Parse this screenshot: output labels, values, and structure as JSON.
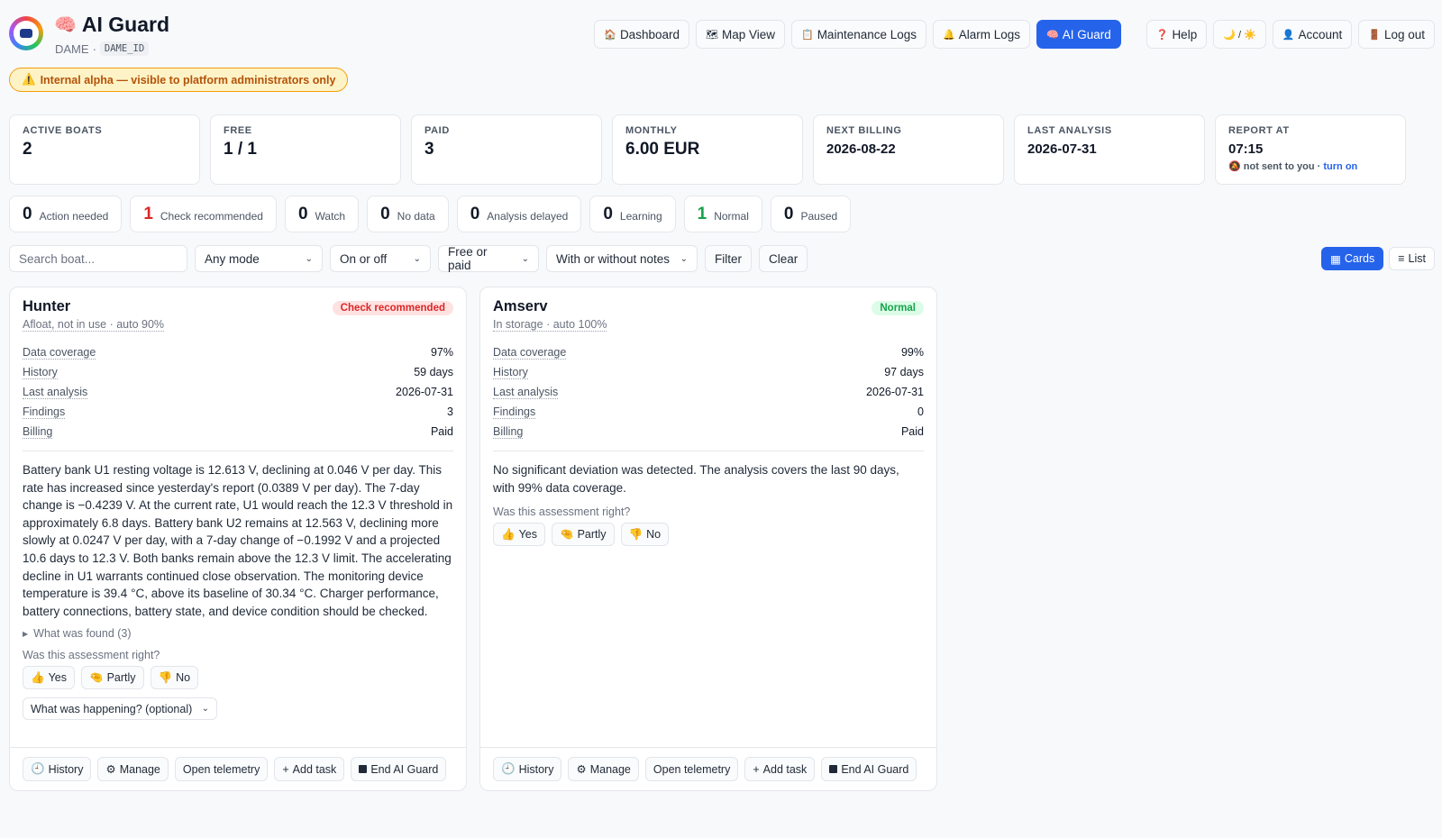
{
  "app": {
    "title": "AI Guard",
    "title_icon": "brain-icon",
    "org": "DAME",
    "separator": "·",
    "org_id": "DAME_ID"
  },
  "nav": [
    {
      "icon": "🏠",
      "icon_name": "home-icon",
      "label": "Dashboard",
      "active": false
    },
    {
      "icon": "🗺",
      "icon_name": "map-icon",
      "label": "Map View",
      "active": false
    },
    {
      "icon": "📋",
      "icon_name": "clipboard-icon",
      "label": "Maintenance Logs",
      "active": false
    },
    {
      "icon": "🔔",
      "icon_name": "bell-icon",
      "label": "Alarm Logs",
      "active": false
    },
    {
      "icon": "🧠",
      "icon_name": "brain-icon",
      "label": "AI Guard",
      "active": true
    }
  ],
  "nav_right": [
    {
      "icon": "❓",
      "icon_name": "help-icon",
      "label": "Help"
    },
    {
      "icon": "",
      "icon_name": "theme-toggle-icon",
      "label": "🌙 / ☀️"
    },
    {
      "icon": "👤",
      "icon_name": "user-icon",
      "label": "Account"
    },
    {
      "icon": "🚪",
      "icon_name": "door-icon",
      "label": "Log out"
    }
  ],
  "alpha_banner": {
    "icon": "⚠️",
    "text": "Internal alpha — visible to platform administrators only"
  },
  "stats": {
    "active_boats": {
      "label": "Active boats",
      "value": "2"
    },
    "free": {
      "label": "Free",
      "value": "1 / 1"
    },
    "paid": {
      "label": "Paid",
      "value": "3"
    },
    "monthly": {
      "label": "Monthly",
      "value": "6.00 EUR"
    },
    "next_billing": {
      "label": "Next billing",
      "value": "2026-08-22"
    },
    "last_analysis": {
      "label": "Last analysis",
      "value": "2026-07-31"
    },
    "report_at": {
      "label": "Report at",
      "value": "07:15",
      "note_icon": "🔕",
      "note": "not sent to you ·",
      "link": "turn on"
    }
  },
  "statuses": [
    {
      "count": "0",
      "label": "Action needed",
      "tone": ""
    },
    {
      "count": "1",
      "label": "Check recommended",
      "tone": "red"
    },
    {
      "count": "0",
      "label": "Watch",
      "tone": ""
    },
    {
      "count": "0",
      "label": "No data",
      "tone": ""
    },
    {
      "count": "0",
      "label": "Analysis delayed",
      "tone": ""
    },
    {
      "count": "0",
      "label": "Learning",
      "tone": ""
    },
    {
      "count": "1",
      "label": "Normal",
      "tone": "green"
    },
    {
      "count": "0",
      "label": "Paused",
      "tone": ""
    }
  ],
  "filters": {
    "search_placeholder": "Search boat...",
    "mode": "Any mode",
    "state": "On or off",
    "billing": "Free or paid",
    "notes": "With or without notes",
    "filter_label": "Filter",
    "clear_label": "Clear"
  },
  "view_toggle": {
    "cards": "Cards",
    "list": "List",
    "active": "cards"
  },
  "colors": {
    "accent": "#2563eb",
    "check": "#dc2626",
    "normal": "#16a34a",
    "warning": "#b45309"
  },
  "cards": [
    {
      "name": "Hunter",
      "status": "Check recommended",
      "mode": "Afloat, not in use · auto 90%",
      "metrics": [
        {
          "label": "Data coverage",
          "value": "97%"
        },
        {
          "label": "History",
          "value": "59 days"
        },
        {
          "label": "Last analysis",
          "value": "2026-07-31"
        },
        {
          "label": "Findings",
          "value": "3"
        },
        {
          "label": "Billing",
          "value": "Paid"
        }
      ],
      "analysis": "Battery bank U1 resting voltage is 12.613 V, declining at 0.046 V per day. This rate has increased since yesterday's report (0.0389 V per day). The 7-day change is −0.4239 V. At the current rate, U1 would reach the 12.3 V threshold in approximately 6.8 days. Battery bank U2 remains at 12.563 V, declining more slowly at 0.0247 V per day, with a 7-day change of −0.1992 V and a projected 10.6 days to 12.3 V. Both banks remain above the 12.3 V limit. The accelerating decline in U1 warrants continued close observation. The monitoring device temperature is 39.4 °C, above its baseline of 30.34 °C. Charger performance, battery connections, battery state, and device condition should be checked.",
      "found": "What was found (3)",
      "assess_question": "Was this assessment right?",
      "feedback": {
        "yes": "Yes",
        "partly": "Partly",
        "no": "No"
      },
      "notes_select": "What was happening? (optional)"
    },
    {
      "name": "Amserv",
      "status": "Normal",
      "mode": "In storage · auto 100%",
      "metrics": [
        {
          "label": "Data coverage",
          "value": "99%"
        },
        {
          "label": "History",
          "value": "97 days"
        },
        {
          "label": "Last analysis",
          "value": "2026-07-31"
        },
        {
          "label": "Findings",
          "value": "0"
        },
        {
          "label": "Billing",
          "value": "Paid"
        }
      ],
      "analysis": "No significant deviation was detected. The analysis covers the last 90 days, with 99% data coverage.",
      "assess_question": "Was this assessment right?",
      "feedback": {
        "yes": "Yes",
        "partly": "Partly",
        "no": "No"
      }
    }
  ],
  "card_actions": {
    "history": "History",
    "manage": "Manage",
    "telemetry": "Open telemetry",
    "add_task": "Add task",
    "end": "End AI Guard"
  },
  "feedback_icons": {
    "yes": "👍",
    "partly": "🤏",
    "no": "👎"
  }
}
